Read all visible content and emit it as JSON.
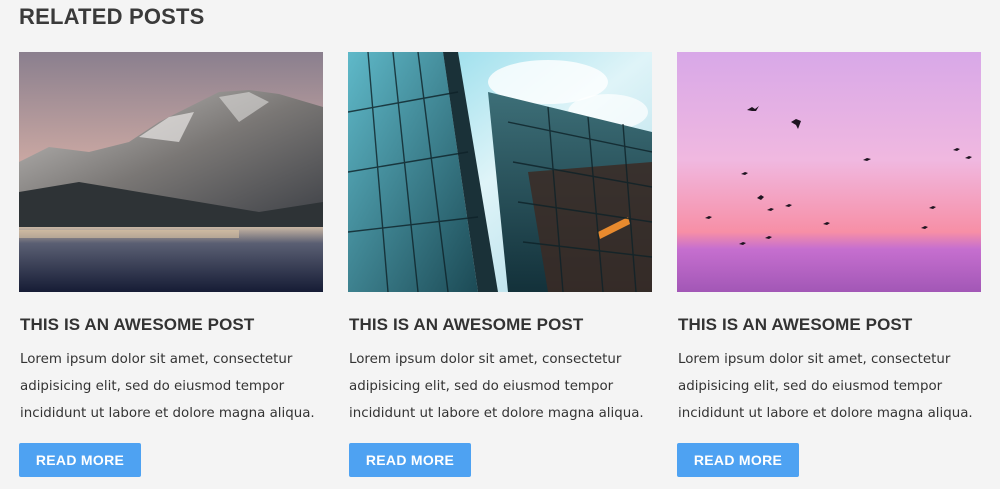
{
  "section": {
    "title": "RELATED POSTS"
  },
  "posts": [
    {
      "image_subject": "mountain lake landscape",
      "title": "THIS IS AN AWESOME POST",
      "excerpt": "Lorem ipsum dolor sit amet, consectetur adipisicing elit, sed do eiusmod tempor incididunt ut labore et dolore magna aliqua.",
      "button_label": "READ MORE"
    },
    {
      "image_subject": "glass skyscrapers looking up",
      "title": "THIS IS AN AWESOME POST",
      "excerpt": "Lorem ipsum dolor sit amet, consectetur adipisicing elit, sed do eiusmod tempor incididunt ut labore et dolore magna aliqua.",
      "button_label": "READ MORE"
    },
    {
      "image_subject": "birds flying in pink sunset sky",
      "title": "THIS IS AN AWESOME POST",
      "excerpt": "Lorem ipsum dolor sit amet, consectetur adipisicing elit, sed do eiusmod tempor incididunt ut labore et dolore magna aliqua.",
      "button_label": "READ MORE"
    }
  ],
  "colors": {
    "background": "#f4f4f4",
    "heading": "#3a3a3a",
    "text": "#333333",
    "button": "#4ea2f2",
    "button_text": "#ffffff"
  }
}
